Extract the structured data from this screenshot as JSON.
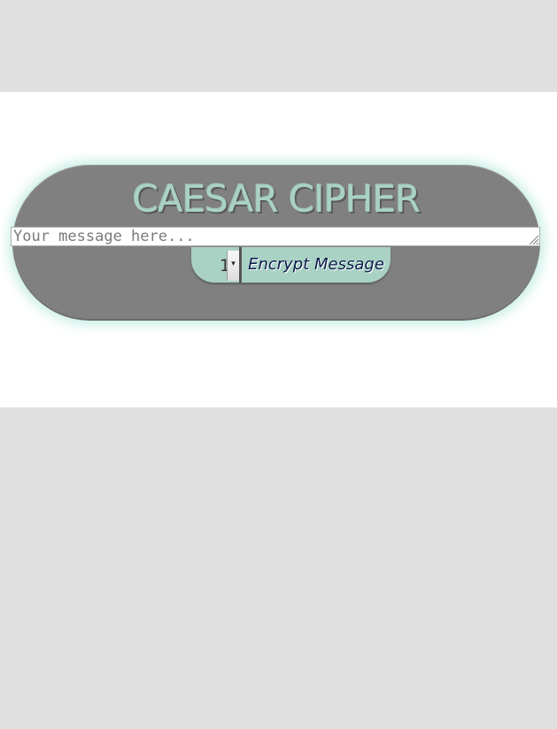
{
  "app": {
    "title": "CAESAR CIPHER"
  },
  "message": {
    "value": "",
    "placeholder": "Your message here..."
  },
  "shift": {
    "selected": "1"
  },
  "actions": {
    "encrypt_label": "Encrypt Message"
  },
  "colors": {
    "page_background": "#e0e0e0",
    "stage_background": "#ffffff",
    "capsule": "#808080",
    "accent_mint": "#a9d2c4",
    "glow": "#c3ece2",
    "button_text": "#0b1a4a"
  },
  "icons": {
    "dropdown": "chevron-down-icon",
    "resize": "resize-grip-icon"
  }
}
